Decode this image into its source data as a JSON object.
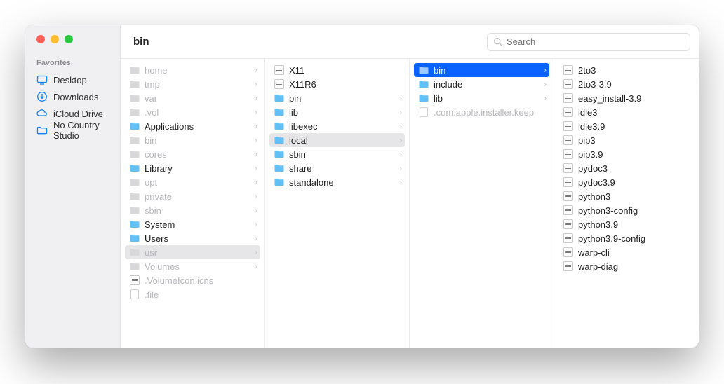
{
  "window": {
    "title": "bin"
  },
  "search": {
    "placeholder": "Search"
  },
  "sidebar": {
    "section_label": "Favorites",
    "items": [
      {
        "label": "Desktop",
        "icon": "desktop"
      },
      {
        "label": "Downloads",
        "icon": "download"
      },
      {
        "label": "iCloud Drive",
        "icon": "cloud"
      },
      {
        "label": "No Country Studio",
        "icon": "folder"
      }
    ]
  },
  "columns": [
    [
      {
        "label": "home",
        "type": "folder",
        "disabled": true,
        "hasChildren": true
      },
      {
        "label": "tmp",
        "type": "folder",
        "disabled": true,
        "hasChildren": true
      },
      {
        "label": "var",
        "type": "folder",
        "disabled": true,
        "hasChildren": true
      },
      {
        "label": ".vol",
        "type": "folder",
        "disabled": true,
        "hasChildren": true
      },
      {
        "label": "Applications",
        "type": "folder",
        "hasChildren": true
      },
      {
        "label": "bin",
        "type": "folder",
        "disabled": true,
        "hasChildren": true
      },
      {
        "label": "cores",
        "type": "folder",
        "disabled": true,
        "hasChildren": true
      },
      {
        "label": "Library",
        "type": "folder",
        "hasChildren": true
      },
      {
        "label": "opt",
        "type": "folder",
        "disabled": true,
        "hasChildren": true
      },
      {
        "label": "private",
        "type": "folder",
        "disabled": true,
        "hasChildren": true
      },
      {
        "label": "sbin",
        "type": "folder",
        "disabled": true,
        "hasChildren": true
      },
      {
        "label": "System",
        "type": "folder",
        "hasChildren": true
      },
      {
        "label": "Users",
        "type": "folder",
        "hasChildren": true
      },
      {
        "label": "usr",
        "type": "folder",
        "disabled": true,
        "hasChildren": true,
        "pathSelected": true
      },
      {
        "label": "Volumes",
        "type": "folder",
        "disabled": true,
        "hasChildren": true
      },
      {
        "label": ".VolumeIcon.icns",
        "type": "exec",
        "disabled": true
      },
      {
        "label": ".file",
        "type": "file",
        "disabled": true
      }
    ],
    [
      {
        "label": "X11",
        "type": "exec"
      },
      {
        "label": "X11R6",
        "type": "exec"
      },
      {
        "label": "bin",
        "type": "folder",
        "hasChildren": true
      },
      {
        "label": "lib",
        "type": "folder",
        "hasChildren": true
      },
      {
        "label": "libexec",
        "type": "folder",
        "hasChildren": true
      },
      {
        "label": "local",
        "type": "folder",
        "hasChildren": true,
        "pathSelected": true
      },
      {
        "label": "sbin",
        "type": "folder",
        "hasChildren": true
      },
      {
        "label": "share",
        "type": "folder",
        "hasChildren": true
      },
      {
        "label": "standalone",
        "type": "folder",
        "hasChildren": true
      }
    ],
    [
      {
        "label": "bin",
        "type": "folder",
        "hasChildren": true,
        "selected": true
      },
      {
        "label": "include",
        "type": "folder",
        "hasChildren": true
      },
      {
        "label": "lib",
        "type": "folder",
        "hasChildren": true
      },
      {
        "label": ".com.apple.installer.keep",
        "type": "file",
        "disabled": true
      }
    ],
    [
      {
        "label": "2to3",
        "type": "exec"
      },
      {
        "label": "2to3-3.9",
        "type": "exec"
      },
      {
        "label": "easy_install-3.9",
        "type": "exec"
      },
      {
        "label": "idle3",
        "type": "exec"
      },
      {
        "label": "idle3.9",
        "type": "exec"
      },
      {
        "label": "pip3",
        "type": "exec"
      },
      {
        "label": "pip3.9",
        "type": "exec"
      },
      {
        "label": "pydoc3",
        "type": "exec"
      },
      {
        "label": "pydoc3.9",
        "type": "exec"
      },
      {
        "label": "python3",
        "type": "exec"
      },
      {
        "label": "python3-config",
        "type": "exec"
      },
      {
        "label": "python3.9",
        "type": "exec"
      },
      {
        "label": "python3.9-config",
        "type": "exec"
      },
      {
        "label": "warp-cli",
        "type": "exec"
      },
      {
        "label": "warp-diag",
        "type": "exec"
      }
    ]
  ]
}
